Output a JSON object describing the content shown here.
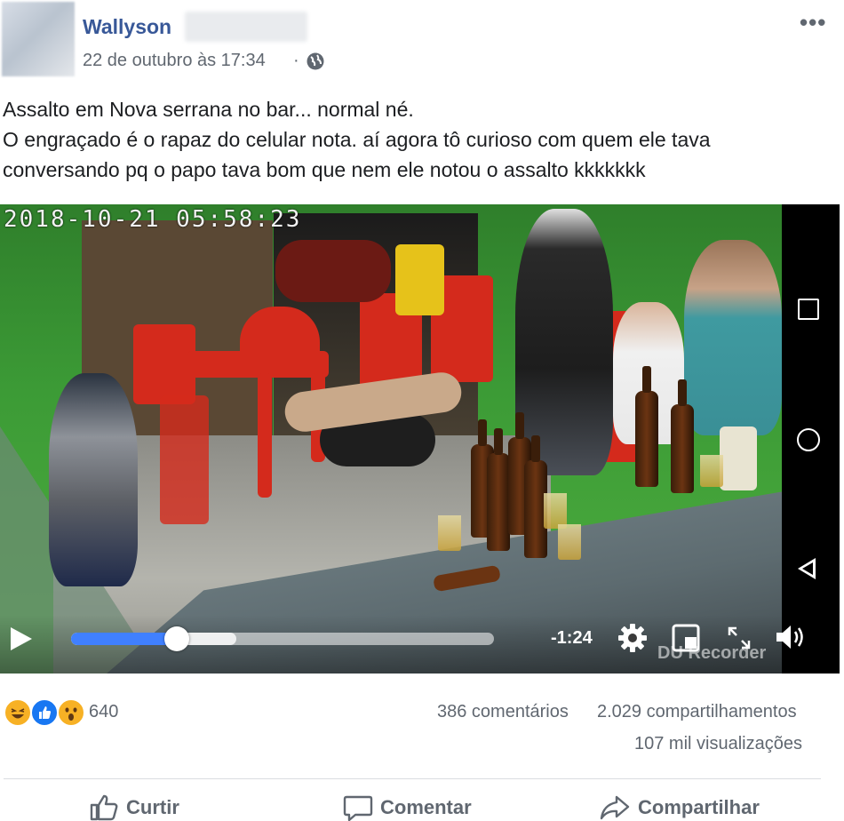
{
  "post": {
    "author": "Wallyson",
    "timestamp": "22 de outubro às 17:34",
    "separator": "·",
    "privacy_icon": "globe-icon",
    "more_label": "•••",
    "text_lines": [
      "Assalto em Nova serrana no bar... normal né.",
      "O engraçado é o rapaz do celular nota. aí agora tô curioso com quem ele tava",
      "conversando pq o papo tava bom que nem ele notou o assalto kkkkkkk"
    ]
  },
  "video": {
    "cctv_timestamp": "2018-10-21  05:58:23",
    "time_remaining": "-1:24",
    "progress": 0.25,
    "buffered": 0.39,
    "watermark": "DU Recorder",
    "icons": [
      "play-icon",
      "settings-icon",
      "miniplayer-icon",
      "fullscreen-icon",
      "volume-icon"
    ],
    "android_nav_icons": [
      "recents-icon",
      "home-icon",
      "back-icon"
    ]
  },
  "stats": {
    "reaction_icons": [
      "haha-icon",
      "like-icon",
      "wow-icon"
    ],
    "reaction_count": "640",
    "comments": "386 comentários",
    "shares": "2.029 compartilhamentos",
    "views": "107 mil visualizações"
  },
  "actions": {
    "like": "Curtir",
    "comment": "Comentar",
    "share": "Compartilhar"
  },
  "colors": {
    "link": "#385898",
    "secondary_text": "#606770",
    "progress": "#4080ff"
  }
}
